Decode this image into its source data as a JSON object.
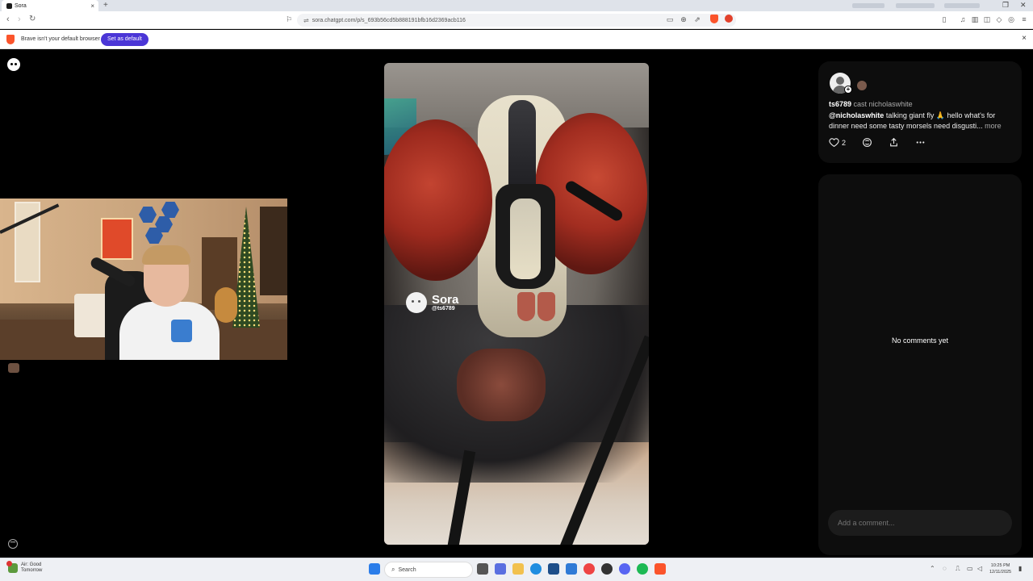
{
  "browser": {
    "tab_title": "Sora",
    "tab_close": "×",
    "new_tab": "+",
    "url": "sora.chatgpt.com/p/s_693b56cd5b888191bfb16d2369acb116",
    "infobar": {
      "message": "Brave isn't your default browser",
      "button": "Set as default",
      "close": "×"
    }
  },
  "post": {
    "username": "ts6789",
    "cast_label": "cast nicholaswhite",
    "mention": "@nicholaswhite",
    "caption": "talking giant fly 🙏 hello what's for dinner need some tasty morsels need disgusti...",
    "more_label": "more",
    "like_count": "2",
    "watermark_name": "Sora",
    "watermark_handle": "@ts6789"
  },
  "comments": {
    "empty_text": "No comments yet",
    "input_placeholder": "Add a comment..."
  },
  "taskbar": {
    "weather_line1": "Air: Good",
    "weather_line2": "Tomorrow",
    "search_placeholder": "Search",
    "time": "10:25 PM",
    "date": "12/11/2025"
  },
  "colors": {
    "accent": "#4b36d6",
    "brave": "#fb542b",
    "page_bg": "#000000",
    "card_bg": "#0d0d0d"
  }
}
